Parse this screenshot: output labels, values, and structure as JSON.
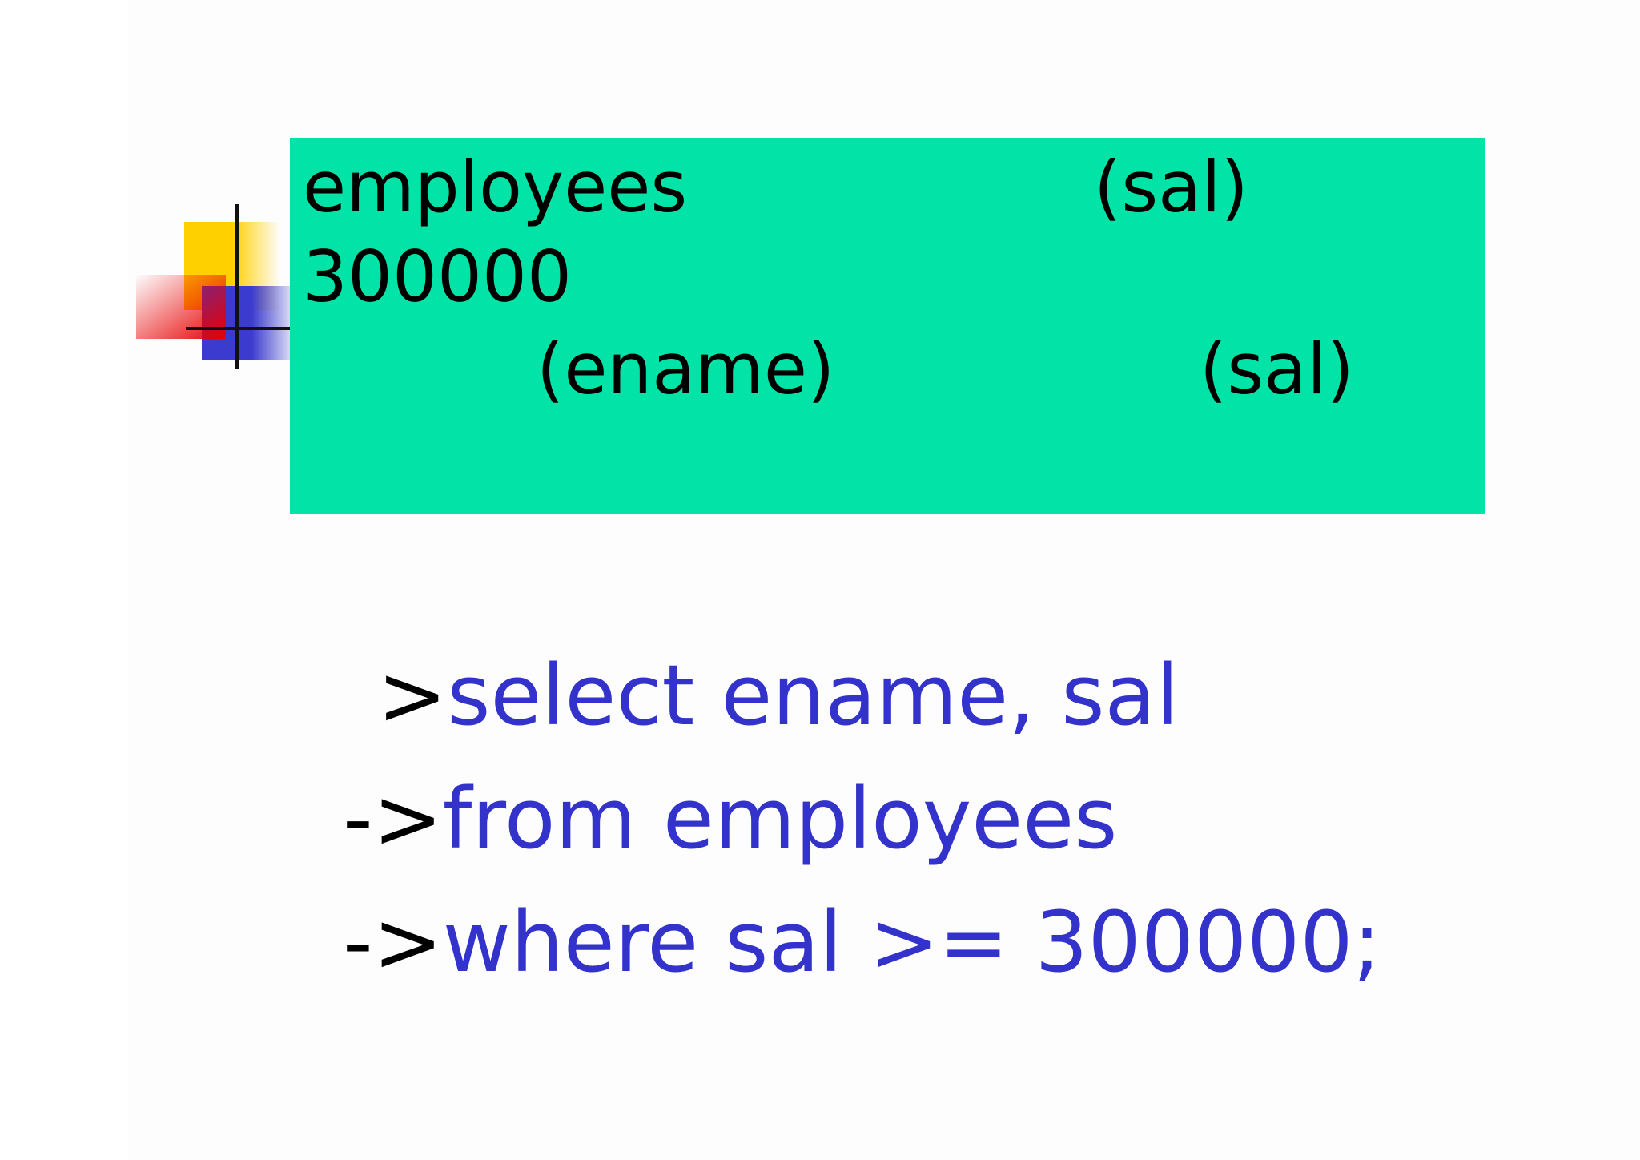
{
  "header_box": {
    "line1_left": "employees",
    "line1_right": "(sal)",
    "line2": "300000",
    "line3_left": "(ename)",
    "line3_right": "(sal)",
    "background": "#02e3a8"
  },
  "query": [
    {
      "prompt": ">",
      "code": "select ename, sal"
    },
    {
      "prompt": "->",
      "code": "from employees"
    },
    {
      "prompt": "->",
      "code": "where sal >= 300000;"
    }
  ],
  "colors": {
    "code": "#3333cc",
    "prompt": "#000000",
    "logo_yellow": "#ffd000",
    "logo_blue": "#3b3bcf",
    "logo_red": "#e80000"
  }
}
